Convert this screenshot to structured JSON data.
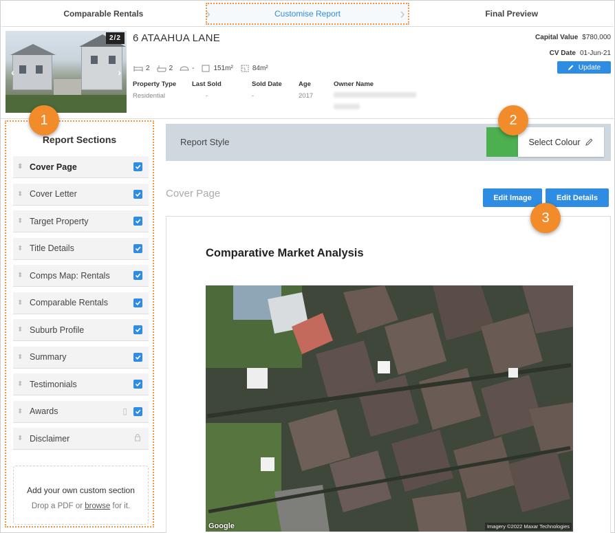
{
  "stepper": {
    "steps": [
      {
        "label": "Comparable Rentals"
      },
      {
        "label": "Customise Report"
      },
      {
        "label": "Final Preview"
      }
    ]
  },
  "property": {
    "photo_counter": "2/2",
    "address": "6 ATAAHUA LANE",
    "bedrooms": "2",
    "bathrooms": "2",
    "car_spaces": "-",
    "floor_area": "151m²",
    "land_area": "84m²",
    "meta": [
      {
        "label": "Property Type",
        "value": "Residential"
      },
      {
        "label": "Last Sold",
        "value": "-"
      },
      {
        "label": "Sold Date",
        "value": "-"
      },
      {
        "label": "Age",
        "value": "2017"
      },
      {
        "label": "Owner Name",
        "value": ""
      }
    ],
    "capital_value_label": "Capital Value",
    "capital_value": "$780,000",
    "cv_date_label": "CV Date",
    "cv_date": "01-Jun-21",
    "update_label": "Update"
  },
  "sidebar": {
    "title": "Report Sections",
    "items": [
      {
        "label": "Cover Page",
        "checked": true
      },
      {
        "label": "Cover Letter",
        "checked": true
      },
      {
        "label": "Target Property",
        "checked": true
      },
      {
        "label": "Title Details",
        "checked": true
      },
      {
        "label": "Comps Map: Rentals",
        "checked": true
      },
      {
        "label": "Comparable Rentals",
        "checked": true
      },
      {
        "label": "Suburb Profile",
        "checked": true
      },
      {
        "label": "Summary",
        "checked": true
      },
      {
        "label": "Testimonials",
        "checked": true
      },
      {
        "label": "Awards",
        "checked": true
      },
      {
        "label": "Disclaimer",
        "locked": true
      }
    ],
    "custom_title": "Add your own custom section",
    "custom_text_prefix": "Drop a PDF or",
    "custom_link": "browse",
    "custom_text_suffix": "for it."
  },
  "report_style": {
    "label": "Report Style",
    "select_colour_label": "Select Colour",
    "colour": "#4caf50"
  },
  "cover": {
    "section_title": "Cover Page",
    "edit_image_label": "Edit Image",
    "edit_details_label": "Edit Details",
    "heading": "Comparative Market Analysis",
    "map_logo": "Google",
    "imagery_credit": "Imagery ©2022 Maxar Technologies"
  },
  "badges": [
    "1",
    "2",
    "3"
  ],
  "colors": {
    "accent": "#2f8ce3",
    "highlight": "#f2953a",
    "badge": "#f28b2a"
  }
}
